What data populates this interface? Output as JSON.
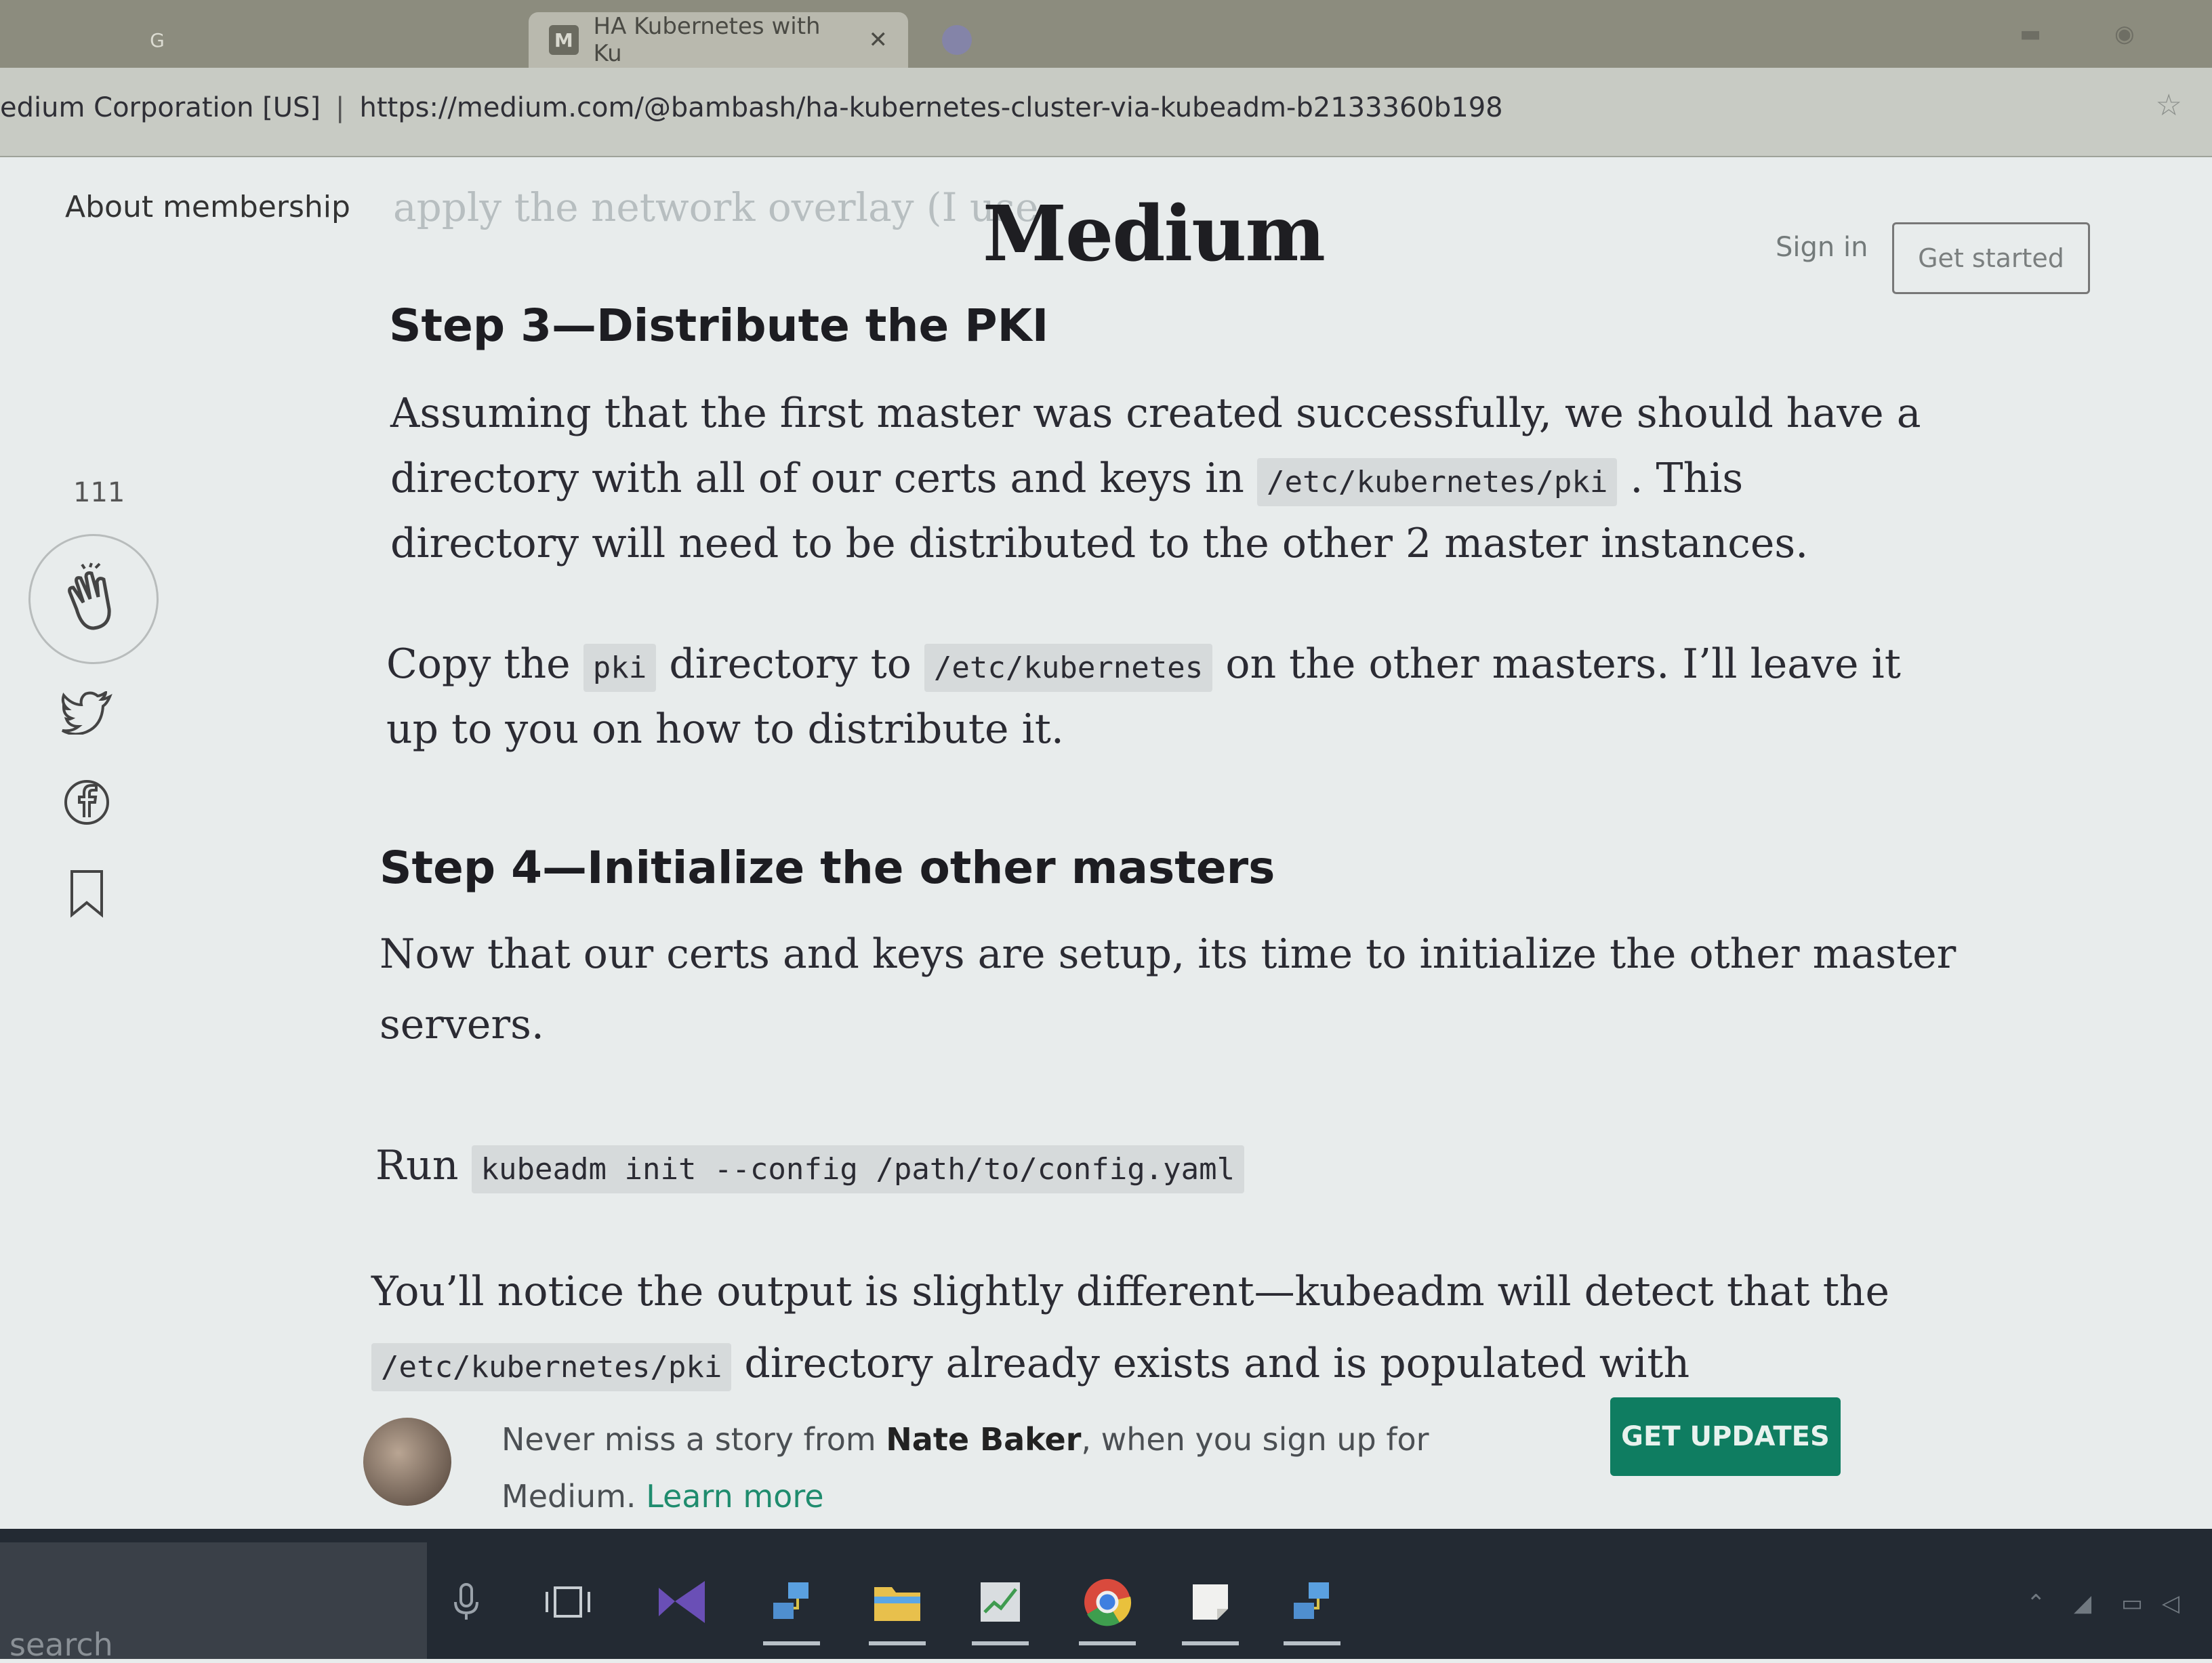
{
  "browser": {
    "tabs": [
      {
        "label": "",
        "active": false
      },
      {
        "label": "HA Kubernetes with Ku",
        "active": true
      },
      {
        "label": "",
        "active": false
      }
    ],
    "security_label": "edium Corporation [US]",
    "url": "https://medium.com/@bambash/ha-kubernetes-cluster-via-kubeadm-b2133360b198"
  },
  "header": {
    "about": "About membership",
    "ghost_text": "apply the network overlay (I use",
    "logo": "Medium",
    "sign_in": "Sign in",
    "get_started": "Get started"
  },
  "rail": {
    "clap_count": "111",
    "icons": [
      "clap-icon",
      "twitter-icon",
      "facebook-icon",
      "bookmark-icon"
    ]
  },
  "article": {
    "step3_title": "Step 3—Distribute the PKI",
    "p1_l1": "Assuming that the first master was created successfully, we should have a",
    "p1_l2_a": "directory with all of our certs and keys in",
    "p1_l2_code": "/etc/kubernetes/pki",
    "p1_l2_b": ". This",
    "p1_l3": "directory will need to be distributed to the other 2 master instances.",
    "p2_l1_a": "Copy the",
    "p2_l1_code1": "pki",
    "p2_l1_b": "directory to",
    "p2_l1_code2": "/etc/kubernetes",
    "p2_l1_c": "on the other masters. I’ll leave it",
    "p2_l2": "up to you on how to distribute it.",
    "step4_title": "Step 4—Initialize the other masters",
    "p3_l1": "Now that our certs and keys are setup, its time to initialize the other master",
    "p3_l2": "servers.",
    "p4_a": "Run",
    "p4_code": "kubeadm init --config /path/to/config.yaml",
    "p5_l1": "You’ll notice the output is slightly different—kubeadm will detect that the",
    "p5_l2_code": "/etc/kubernetes/pki",
    "p5_l2_b": "directory already exists and is populated with"
  },
  "promo": {
    "text_a": "Never miss a story from ",
    "author": "Nate Baker",
    "text_b": ", when you sign up for",
    "text_c": "Medium. ",
    "learn_more": "Learn more",
    "button": "GET UPDATES"
  },
  "taskbar": {
    "search": "search"
  },
  "colors": {
    "accent": "#0f7d61",
    "link": "#1f8c6e",
    "code_bg": "#d6dadb"
  }
}
